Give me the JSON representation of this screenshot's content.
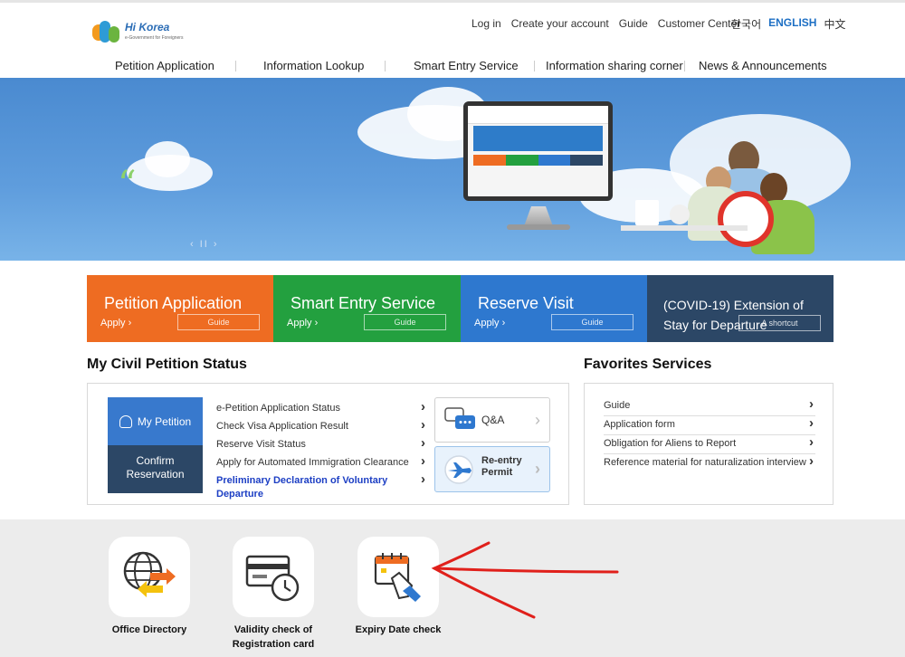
{
  "header": {
    "util_links": [
      "Log in",
      "Create your account",
      "Guide",
      "Customer Center"
    ],
    "languages": [
      "한국어",
      "ENGLISH",
      "中文"
    ],
    "active_language": "ENGLISH",
    "logo": {
      "mark": "Hi Korea",
      "sub": "e-Government for Foreigners"
    }
  },
  "gnb": [
    "Petition Application",
    "Information Lookup",
    "Smart Entry Service",
    "Information sharing corner",
    "News & Announcements"
  ],
  "banner": {
    "controls": "‹  II  ›"
  },
  "quick_tiles": [
    {
      "title": "Petition Application",
      "action": "Apply",
      "button": "Guide",
      "color": "#ee6c22"
    },
    {
      "title": "Smart Entry Service",
      "action": "Apply",
      "button": "Guide",
      "color": "#23a03f"
    },
    {
      "title": "Reserve Visit",
      "action": "Apply",
      "button": "Guide",
      "color": "#2e78cf"
    },
    {
      "title": "(COVID-19) Extension of Stay for Departure",
      "action": "",
      "button": "A shortcut",
      "color": "#2c4766"
    }
  ],
  "status": {
    "title": "My Civil Petition Status",
    "my_petition": "My Petition",
    "confirm": "Confirm Reservation",
    "links": [
      "e-Petition Application Status",
      "Check Visa Application Result",
      "Reserve Visit Status",
      "Apply for Automated Immigration Clearance",
      "Preliminary Declaration of Voluntary Departure"
    ],
    "qa": "Q&A",
    "reentry": "Re-entry Permit"
  },
  "favorites": {
    "title": "Favorites Services",
    "items": [
      "Guide",
      "Application form",
      "Obligation for Aliens to Report",
      "Reference material for naturalization interview"
    ]
  },
  "quick_icons": [
    "Office Directory",
    "Validity check of Registration card",
    "Expiry Date check"
  ],
  "colors": {
    "annotation_arrow": "#e0201b",
    "link_highlight": "#1d3fc4"
  }
}
